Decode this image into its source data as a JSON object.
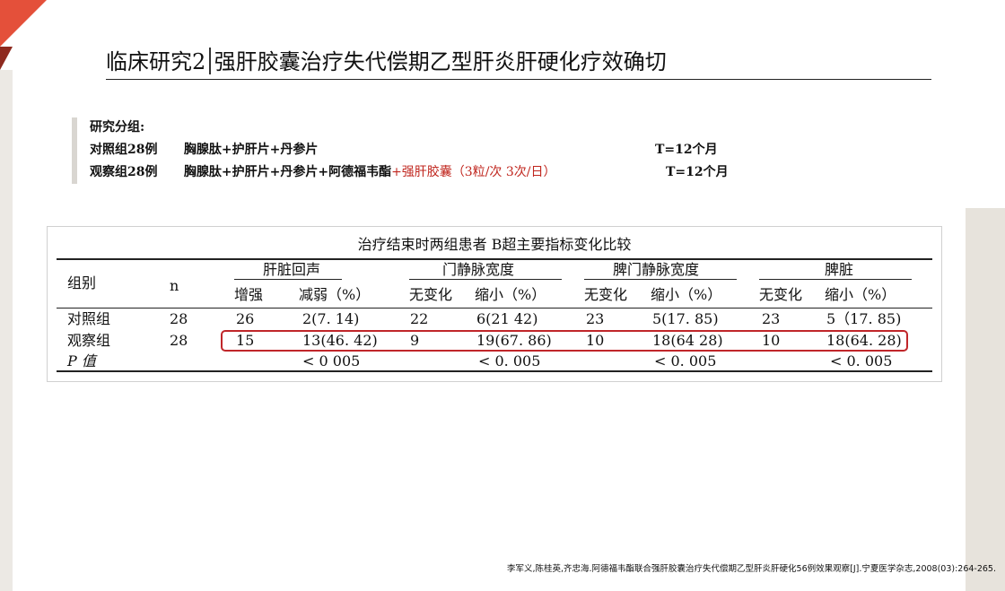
{
  "title": {
    "prefix": "临床研究2",
    "main": "强肝胶囊治疗失代偿期乙型肝炎肝硬化疗效确切"
  },
  "groups": {
    "heading": "研究分组:",
    "control": {
      "label": "对照组28例",
      "regimen": "胸腺肽+护肝片+丹参片",
      "duration": "T=12个月"
    },
    "observation": {
      "label": "观察组28例",
      "regimen": "胸腺肽+护肝片+丹参片+阿德福韦酯",
      "highlight": "+强肝胶囊（3粒/次 3次/日）",
      "duration": "T=12个月"
    }
  },
  "table": {
    "title": "治疗结束时两组患者 B超主要指标变化比较",
    "col_group": "组别",
    "col_n": "n",
    "sections": [
      "肝脏回声",
      "门静脉宽度",
      "脾门静脉宽度",
      "脾脏"
    ],
    "subheaders": [
      "增强",
      "减弱（%）",
      "无变化",
      "缩小（%）",
      "无变化",
      "缩小（%）",
      "无变化",
      "缩小（%）"
    ],
    "rows": [
      {
        "group": "对照组",
        "n": "28",
        "cells": [
          "26",
          "2(7. 14)",
          "22",
          "6(21 42)",
          "23",
          "5(17. 85)",
          "23",
          "5（17. 85)"
        ]
      },
      {
        "group": "观察组",
        "n": "28",
        "cells": [
          "15",
          "13(46. 42)",
          "9",
          "19(67. 86)",
          "10",
          "18(64 28)",
          "10",
          "18(64. 28)"
        ]
      }
    ],
    "p_label": "P 值",
    "p_values": [
      "< 0 005",
      "< 0. 005",
      "< 0. 005",
      "< 0. 005"
    ]
  },
  "citation": "李军义,陈桂英,齐忠海.阿德福韦酯联合强肝胶囊治疗失代偿期乙型肝炎肝硬化56例效果观察[J].宁夏医学杂志,2008(03):264-265.",
  "colors": {
    "accent_red": "#e4503a",
    "highlight_red": "#c0261e"
  }
}
